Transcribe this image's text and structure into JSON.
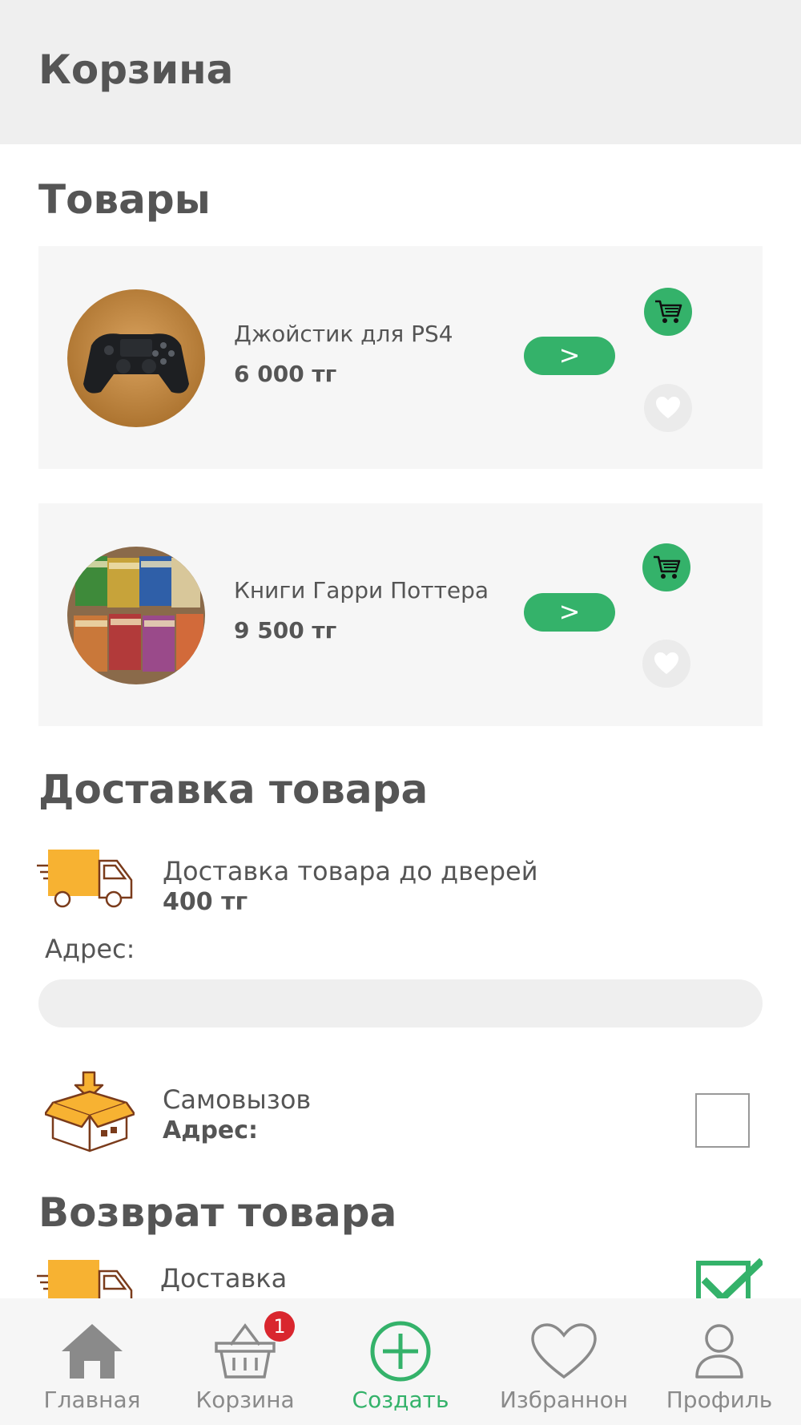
{
  "header": {
    "title": "Корзина"
  },
  "sections": {
    "products": "Товары",
    "delivery": "Доставка товара",
    "return": "Возврат товара"
  },
  "products": [
    {
      "name": "Джойстик для PS4",
      "price": "6 000 тг",
      "go_label": ">"
    },
    {
      "name": "Книги Гарри Поттера",
      "price": "9 500 тг",
      "go_label": ">"
    }
  ],
  "delivery": {
    "door_title": "Доставка товара до дверей",
    "door_price": "400 тг",
    "address_label": "Адрес:",
    "address_value": "",
    "address_placeholder": "",
    "pickup_title": "Самовызов",
    "pickup_address_label": "Адрес:",
    "pickup_checked": false
  },
  "return": {
    "option_title": "Доставка",
    "option_checked": true
  },
  "nav": {
    "items": [
      {
        "label": "Главная",
        "icon": "home-icon",
        "active": false
      },
      {
        "label": "Корзина",
        "icon": "basket-icon",
        "active": false,
        "badge": "1"
      },
      {
        "label": "Создать",
        "icon": "plus-circle-icon",
        "active": true
      },
      {
        "label": "Избраннон",
        "icon": "heart-icon",
        "active": false
      },
      {
        "label": "Профиль",
        "icon": "user-icon",
        "active": false
      }
    ]
  },
  "colors": {
    "accent": "#34b26a",
    "badge": "#d9262e",
    "truck": "#f7b232",
    "header_bg": "#efefef",
    "card_bg": "#f6f6f6"
  }
}
